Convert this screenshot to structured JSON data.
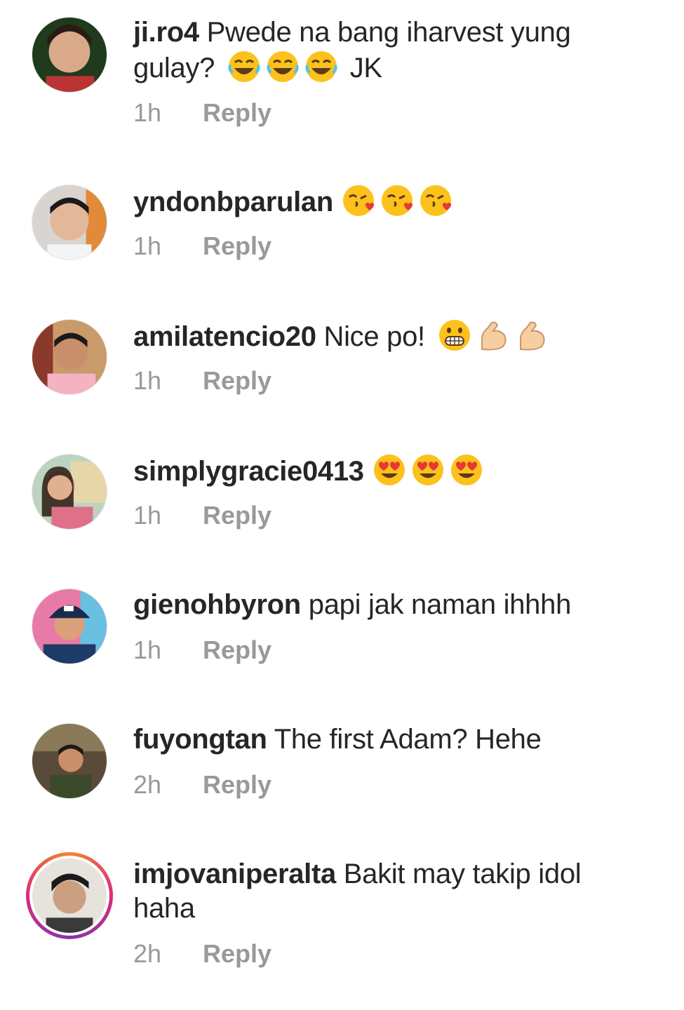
{
  "comments": [
    {
      "username": "ji.ro4",
      "text_before": "Pwede na bang iharvest yung gulay?",
      "text_after": "JK",
      "emojis": [
        "joy-emoji",
        "joy-emoji",
        "joy-emoji"
      ],
      "time": "1h",
      "reply": "Reply"
    },
    {
      "username": "yndonbparulan",
      "text_before": "",
      "text_after": "",
      "emojis": [
        "kissing-heart-emoji",
        "kissing-heart-emoji",
        "kissing-heart-emoji"
      ],
      "time": "1h",
      "reply": "Reply"
    },
    {
      "username": "amilatencio20",
      "text_before": "Nice po!",
      "text_after": "",
      "emojis": [
        "grimacing-emoji",
        "flexed-biceps-emoji",
        "flexed-biceps-emoji"
      ],
      "time": "1h",
      "reply": "Reply"
    },
    {
      "username": "simplygracie0413",
      "text_before": "",
      "text_after": "",
      "emojis": [
        "heart-eyes-emoji",
        "heart-eyes-emoji",
        "heart-eyes-emoji"
      ],
      "time": "1h",
      "reply": "Reply"
    },
    {
      "username": "gienohbyron",
      "text_before": "papi jak naman ihhhh",
      "text_after": "",
      "emojis": [],
      "time": "1h",
      "reply": "Reply"
    },
    {
      "username": "fuyongtan",
      "text_before": "The first Adam? Hehe",
      "text_after": "",
      "emojis": [],
      "time": "2h",
      "reply": "Reply"
    },
    {
      "username": "imjovaniperalta",
      "text_before": "Bakit may takip idol haha",
      "text_after": "",
      "emojis": [],
      "time": "2h",
      "reply": "Reply",
      "has_story": true
    }
  ],
  "colors": {
    "username": "#262626",
    "meta": "#999999",
    "story_ring": "#dd2a7b"
  }
}
